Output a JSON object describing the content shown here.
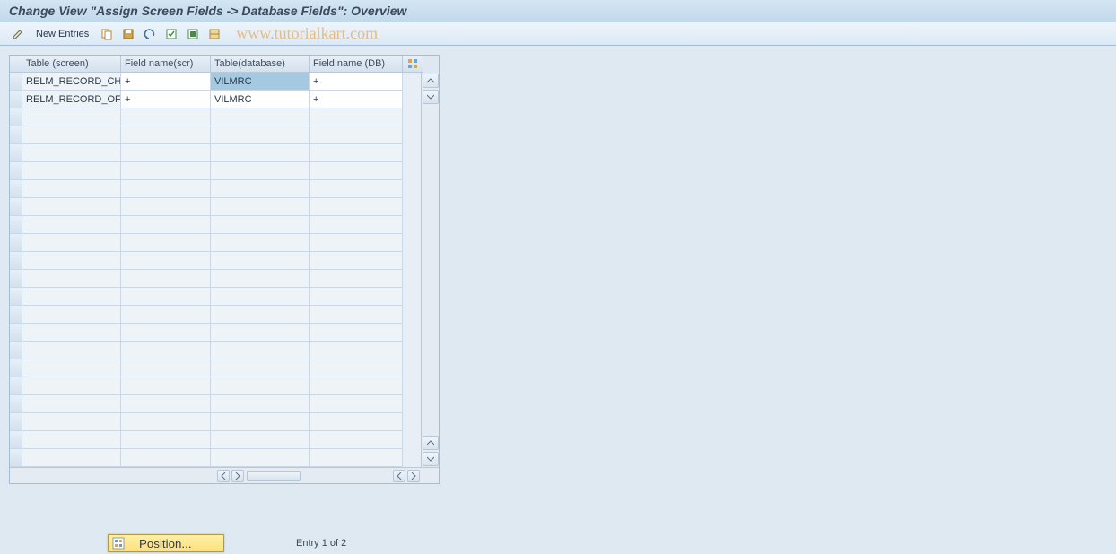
{
  "title": "Change View \"Assign Screen Fields -> Database Fields\": Overview",
  "toolbar": {
    "new_entries": "New Entries"
  },
  "watermark": "www.tutorialkart.com",
  "columns": [
    "Table (screen)",
    "Field name(scr)",
    "Table(database)",
    "Field name (DB)"
  ],
  "rows": [
    {
      "table_screen": "RELM_RECORD_CH…",
      "field_scr": "+",
      "table_db": "VILMRC",
      "field_db": "+"
    },
    {
      "table_screen": "RELM_RECORD_OF…",
      "field_scr": "+",
      "table_db": "VILMRC",
      "field_db": "+"
    }
  ],
  "status": {
    "position_label": "Position...",
    "entry_text": "Entry 1 of 2"
  },
  "icons": {
    "pencil": "pencil",
    "copy": "copy",
    "save": "save",
    "undo": "undo",
    "select_all": "select-all",
    "select_block": "select-block",
    "delimit": "delimit",
    "config": "config"
  }
}
